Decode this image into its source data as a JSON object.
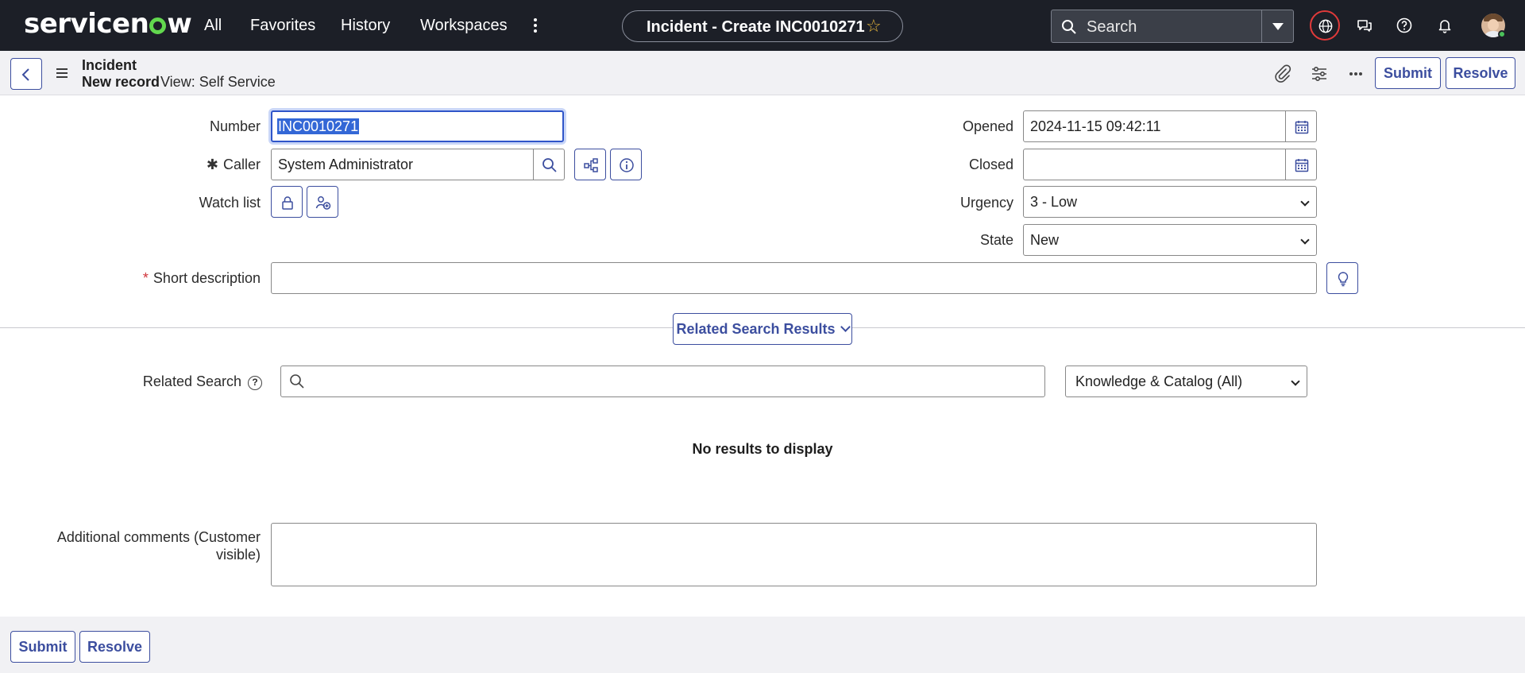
{
  "topnav": {
    "logo_text": "servicenow",
    "links": [
      "All",
      "Favorites",
      "History",
      "Workspaces"
    ],
    "record_title": "Incident - Create INC0010271",
    "search_placeholder": "Search",
    "icons": [
      "globe-icon",
      "chat-icon",
      "help-icon",
      "bell-icon",
      "avatar"
    ]
  },
  "header": {
    "table": "Incident",
    "record": "New record",
    "view": "View: Self Service",
    "submit_label": "Submit",
    "resolve_label": "Resolve"
  },
  "form": {
    "number_label": "Number",
    "number_value": "INC0010271",
    "caller_label": "Caller",
    "caller_value": "System Administrator",
    "watchlist_label": "Watch list",
    "opened_label": "Opened",
    "opened_value": "2024-11-15 09:42:11",
    "closed_label": "Closed",
    "closed_value": "",
    "urgency_label": "Urgency",
    "urgency_value": "3 - Low",
    "state_label": "State",
    "state_value": "New",
    "short_description_label": "Short description",
    "short_description_value": "",
    "required_marker": "*",
    "required_marker_filled": "✱"
  },
  "related": {
    "toggle_label": "Related Search Results",
    "search_label": "Related Search",
    "help_glyph": "?",
    "search_value": "",
    "scope_value": "Knowledge & Catalog (All)",
    "empty_message": "No results to display"
  },
  "comments": {
    "label_line1": "Additional comments (Customer",
    "label_line2": "visible)",
    "value": ""
  },
  "footer": {
    "submit_label": "Submit",
    "resolve_label": "Resolve"
  },
  "colors": {
    "nav_bg": "#1c1f27",
    "accent": "#3c4e9f",
    "logo_green": "#62d84e",
    "required": "#d0343a",
    "focus": "#2f55c9"
  }
}
